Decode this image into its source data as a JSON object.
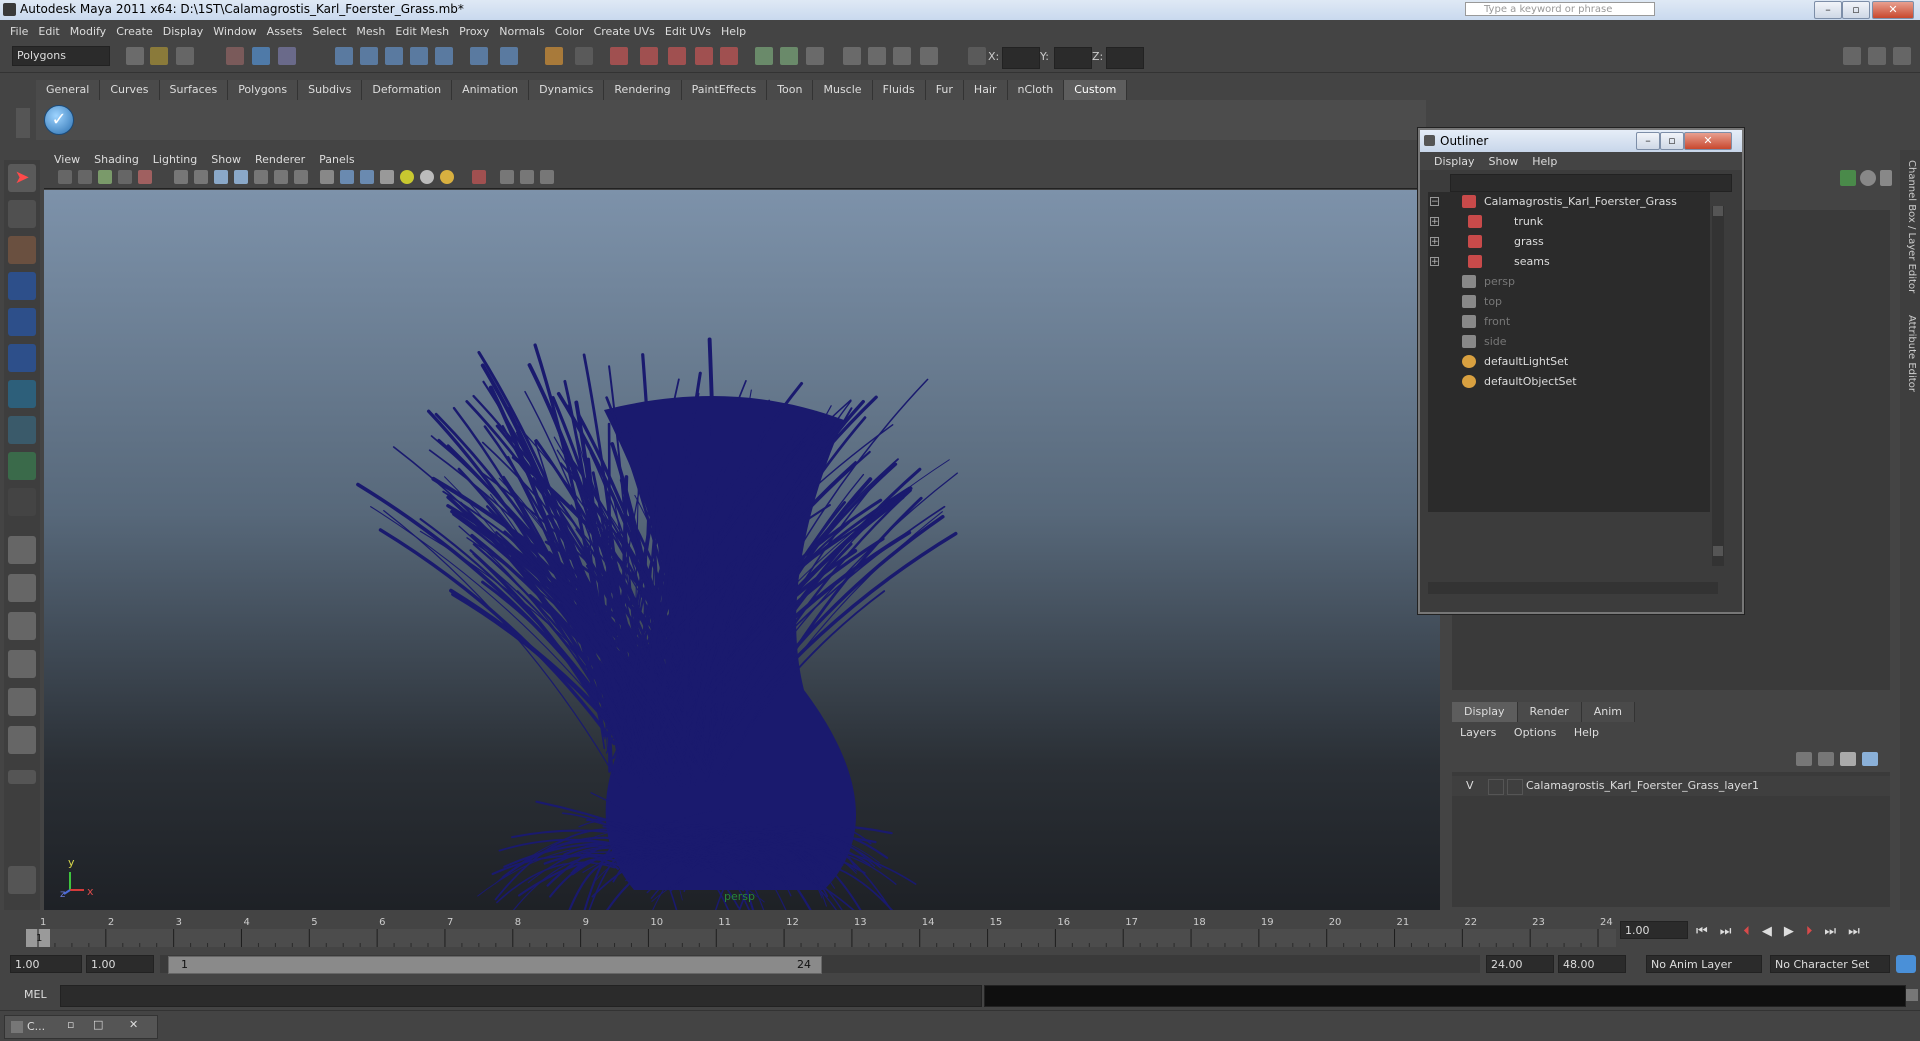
{
  "window": {
    "title": "Autodesk Maya 2011 x64: D:\\1ST\\Calamagrostis_Karl_Foerster_Grass.mb*",
    "help_search_placeholder": "Type a keyword or phrase"
  },
  "menubar": [
    "File",
    "Edit",
    "Modify",
    "Create",
    "Display",
    "Window",
    "Assets",
    "Select",
    "Mesh",
    "Edit Mesh",
    "Proxy",
    "Normals",
    "Color",
    "Create UVs",
    "Edit UVs",
    "Help"
  ],
  "statusline": {
    "mode": "Polygons",
    "x_label": "X:",
    "y_label": "Y:",
    "z_label": "Z:"
  },
  "shelf": {
    "tabs": [
      "General",
      "Curves",
      "Surfaces",
      "Polygons",
      "Subdivs",
      "Deformation",
      "Animation",
      "Dynamics",
      "Rendering",
      "PaintEffects",
      "Toon",
      "Muscle",
      "Fluids",
      "Fur",
      "Hair",
      "nCloth",
      "Custom"
    ],
    "active_tab": "Custom"
  },
  "viewport": {
    "menu": [
      "View",
      "Shading",
      "Lighting",
      "Show",
      "Renderer",
      "Panels"
    ],
    "camera_label": "persp",
    "axis_y": "y",
    "axis_x": "x",
    "axis_z": "z",
    "object_color": "#1a1a6e"
  },
  "outliner": {
    "title": "Outliner",
    "menu": [
      "Display",
      "Show",
      "Help"
    ],
    "items": [
      {
        "label": "Calamagrostis_Karl_Foerster_Grass",
        "kind": "group",
        "expander": "−",
        "dim": false
      },
      {
        "label": "trunk",
        "kind": "mesh",
        "expander": "+",
        "dim": false
      },
      {
        "label": "grass",
        "kind": "mesh",
        "expander": "+",
        "dim": false
      },
      {
        "label": "seams",
        "kind": "mesh",
        "expander": "+",
        "dim": false
      },
      {
        "label": "persp",
        "kind": "camera",
        "expander": "",
        "dim": true
      },
      {
        "label": "top",
        "kind": "camera",
        "expander": "",
        "dim": true
      },
      {
        "label": "front",
        "kind": "camera",
        "expander": "",
        "dim": true
      },
      {
        "label": "side",
        "kind": "camera",
        "expander": "",
        "dim": true
      },
      {
        "label": "defaultLightSet",
        "kind": "set",
        "expander": "",
        "dim": false
      },
      {
        "label": "defaultObjectSet",
        "kind": "set",
        "expander": "",
        "dim": false
      }
    ]
  },
  "layers": {
    "tabs": [
      "Display",
      "Render",
      "Anim"
    ],
    "active_tab": "Display",
    "menu": [
      "Layers",
      "Options",
      "Help"
    ],
    "layer_visibility": "V",
    "layer_name": "Calamagrostis_Karl_Foerster_Grass_layer1"
  },
  "side_tabs": [
    "Channel Box / Layer Editor",
    "Attribute Editor"
  ],
  "timeline": {
    "ticks": [
      "1",
      "2",
      "3",
      "4",
      "5",
      "6",
      "7",
      "8",
      "9",
      "10",
      "11",
      "12",
      "13",
      "14",
      "15",
      "16",
      "17",
      "18",
      "19",
      "20",
      "21",
      "22",
      "23",
      "24"
    ],
    "current_frame_marker": "1",
    "current_frame": "1.00"
  },
  "range": {
    "start": "1.00",
    "playback_start": "1.00",
    "slider_left": "1",
    "slider_right": "24",
    "playback_end": "24.00",
    "end": "48.00",
    "anim_layer": "No Anim Layer",
    "character_set": "No Character Set"
  },
  "cmdline": {
    "label": "MEL"
  },
  "taskbar": {
    "label": "C..."
  }
}
